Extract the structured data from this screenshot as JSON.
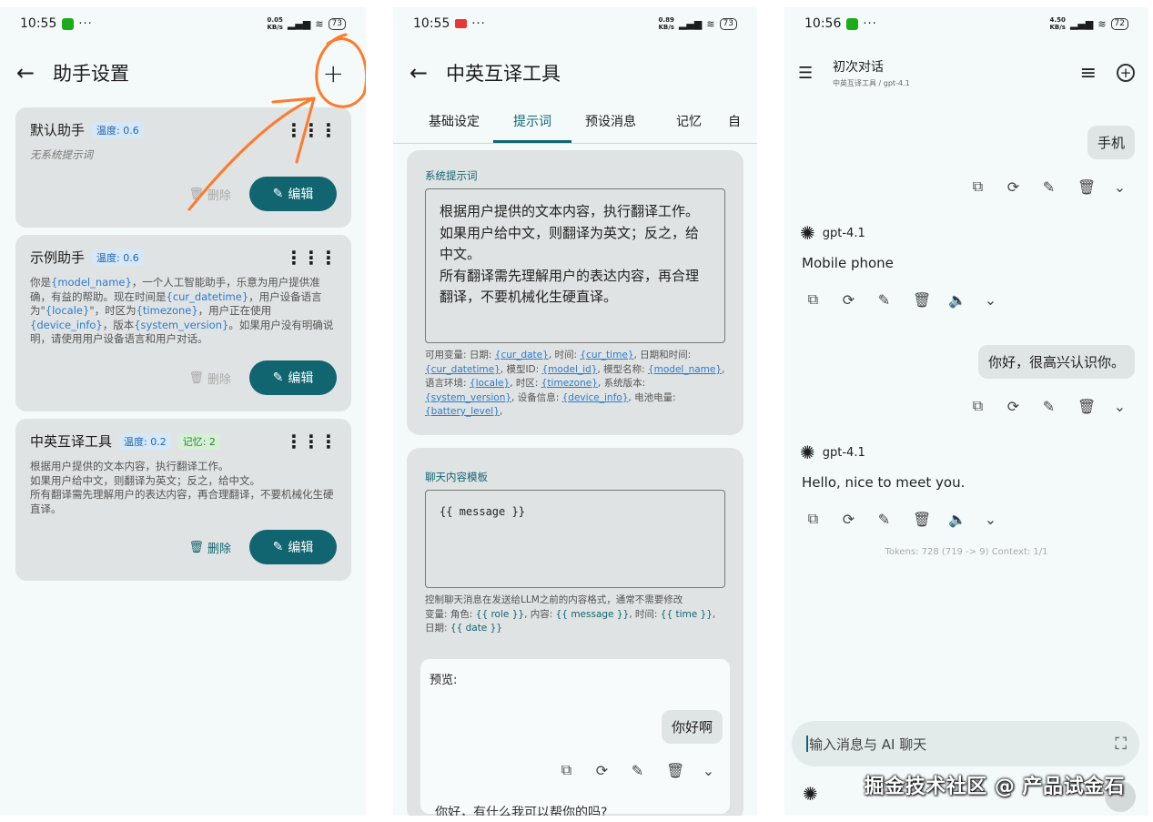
{
  "panel1": {
    "status": {
      "time": "10:55",
      "speed_top": "0.05",
      "speed_bottom": "KB/s",
      "battery": "73"
    },
    "header": {
      "title": "助手设置"
    },
    "cards": [
      {
        "name": "默认助手",
        "temp": "温度: 0.6",
        "desc": "无系统提示词",
        "delete_label": "删除",
        "edit_label": "编辑"
      },
      {
        "name": "示例助手",
        "temp": "温度: 0.6",
        "desc_parts": [
          "你是",
          "{model_name}",
          "，一个人工智能助手，乐意为用户提供准确，有益的帮助。现在时间是",
          "{cur_datetime}",
          "，用户设备语言为\"",
          "{locale}",
          "\"，时区为",
          "{timezone}",
          "，用户正在使用",
          "{device_info}",
          "，版本",
          "{system_version}",
          "。如果用户没有明确说明，请使用用户设备语言和用户对话。"
        ],
        "delete_label": "删除",
        "edit_label": "编辑"
      },
      {
        "name": "中英互译工具",
        "temp": "温度: 0.2",
        "memory": "记忆: 2",
        "desc": "根据用户提供的文本内容，执行翻译工作。\n如果用户给中文，则翻译为英文；反之，给中文。\n所有翻译需先理解用户的表达内容，再合理翻译，不要机械化生硬直译。",
        "delete_label": "删除",
        "edit_label": "编辑"
      }
    ]
  },
  "panel2": {
    "status": {
      "time": "10:55",
      "speed_top": "0.89",
      "speed_bottom": "KB/s",
      "battery": "73"
    },
    "header": {
      "title": "中英互译工具"
    },
    "tabs": [
      "基础设定",
      "提示词",
      "预设消息",
      "记忆",
      "自"
    ],
    "system_prompt": {
      "label": "系统提示词",
      "text": "根据用户提供的文本内容，执行翻译工作。\n如果用户给中文，则翻译为英文；反之，给中文。\n所有翻译需先理解用户的表达内容，再合理翻译，不要机械化生硬直译。",
      "hint_parts": [
        "可用变量: 日期: ",
        "{cur_date}",
        ", 时间: ",
        "{cur_time}",
        ", 日期和时间: ",
        "{cur_datetime}",
        ", 模型ID: ",
        "{model_id}",
        ", 模型名称: ",
        "{model_name}",
        ", 语言环境: ",
        "{locale}",
        ", 时区: ",
        "{timezone}",
        ", 系统版本: ",
        "{system_version}",
        ", 设备信息: ",
        "{device_info}",
        ", 电池电量: ",
        "{battery_level}",
        ","
      ]
    },
    "template": {
      "label": "聊天内容模板",
      "text": "{{ message }}",
      "hint_parts": [
        "控制聊天消息在发送给LLM之前的内容格式，通常不需要修改\n变量: 角色: ",
        "{{ role }}",
        ", 内容: ",
        "{{ message }}",
        ", 时间: ",
        "{{ time }}",
        ", 日期: ",
        "{{ date }}"
      ]
    },
    "preview": {
      "label": "预览:",
      "user_msg": "你好啊",
      "reply_cut": "你好，有什么我可以帮你的吗?"
    }
  },
  "panel3": {
    "status": {
      "time": "10:56",
      "speed_top": "4.50",
      "speed_bottom": "KB/s",
      "battery": "72"
    },
    "header": {
      "title": "初次对话",
      "subtitle": "中英互译工具 / gpt-4.1"
    },
    "messages": [
      {
        "role": "user",
        "text": "手机"
      },
      {
        "role": "assistant",
        "model": "gpt-4.1",
        "text": "Mobile phone"
      },
      {
        "role": "user",
        "text": "你好，很高兴认识你。"
      },
      {
        "role": "assistant",
        "model": "gpt-4.1",
        "text": "Hello, nice to meet you."
      }
    ],
    "tokens": "Tokens: 728 (719 -> 9)   Context: 1/1",
    "input": {
      "placeholder": "输入消息与 AI 聊天"
    },
    "watermark": "掘金技术社区 @ 产品试金石"
  }
}
